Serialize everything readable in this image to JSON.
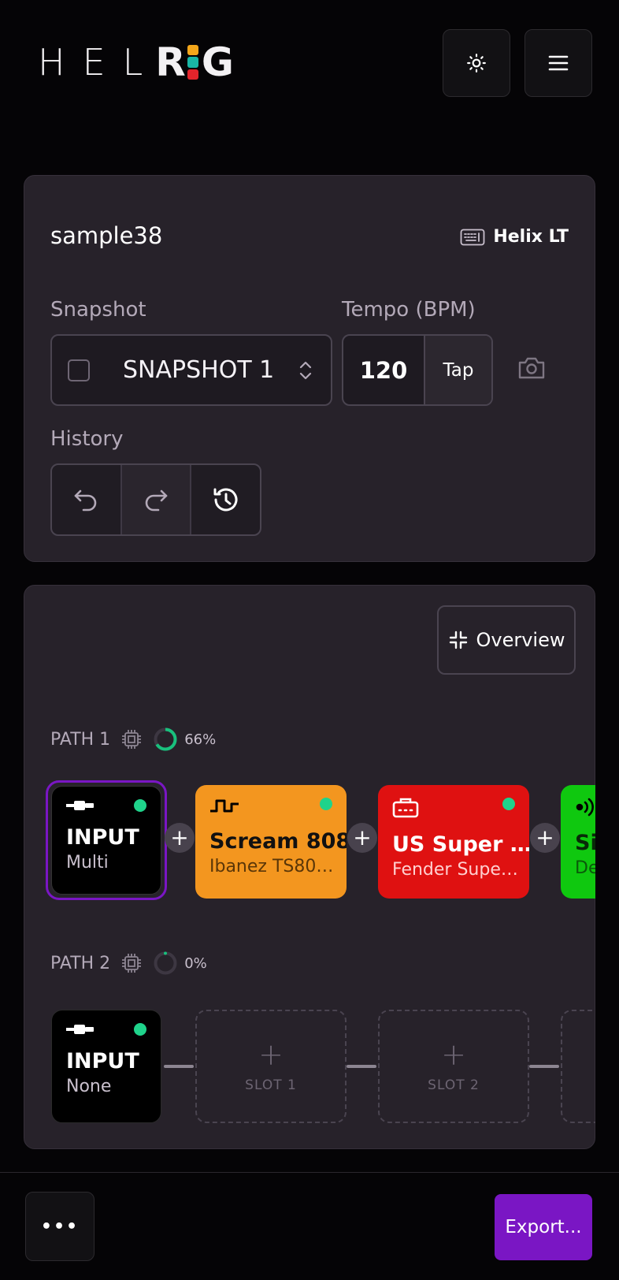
{
  "header": {
    "logo_thin": "HEL",
    "logo_r": "R",
    "logo_g": "G",
    "logo_colors": [
      "#f4a61a",
      "#19b6a6",
      "#e3242b"
    ],
    "theme_icon": "sun-icon",
    "menu_icon": "hamburger-icon"
  },
  "preset": {
    "name": "sample38",
    "device": "Helix LT",
    "device_icon": "keyboard-device-icon"
  },
  "snapshot": {
    "label": "Snapshot",
    "value": "SNAPSHOT 1"
  },
  "tempo": {
    "label": "Tempo (BPM)",
    "value": "120",
    "tap_label": "Tap"
  },
  "history": {
    "label": "History",
    "undo_icon": "undo-icon",
    "redo_icon": "redo-icon",
    "history_icon": "history-icon"
  },
  "overview": {
    "label": "Overview"
  },
  "paths": [
    {
      "label": "PATH 1",
      "dsp_percent": "66%",
      "dsp_fraction": 0.66,
      "blocks": [
        {
          "name": "INPUT",
          "sub": "Multi",
          "color": "#000000",
          "icon": "input-jack-icon"
        },
        {
          "name": "Scream 808",
          "sub": "Ibanez TS80…",
          "color": "#f3961f",
          "icon": "distortion-wave-icon"
        },
        {
          "name": "US Super …",
          "sub": "Fender Supe…",
          "color": "#df1111",
          "icon": "amp-icon"
        },
        {
          "name": "Si",
          "sub": "De",
          "color": "#0fc80f",
          "icon": "wireless-icon"
        }
      ]
    },
    {
      "label": "PATH 2",
      "dsp_percent": "0%",
      "dsp_fraction": 0.0,
      "blocks": [
        {
          "name": "INPUT",
          "sub": "None",
          "color": "#000000",
          "icon": "input-jack-icon"
        }
      ],
      "slots": [
        "SLOT 1",
        "SLOT 2"
      ]
    }
  ],
  "footer": {
    "more_label": "•••",
    "export_label": "Export..."
  },
  "colors": {
    "background": "#050406",
    "card": "#27222a",
    "accent": "#7a16c4",
    "led": "#1fd38b",
    "dsp_ring": "#19c07d"
  }
}
